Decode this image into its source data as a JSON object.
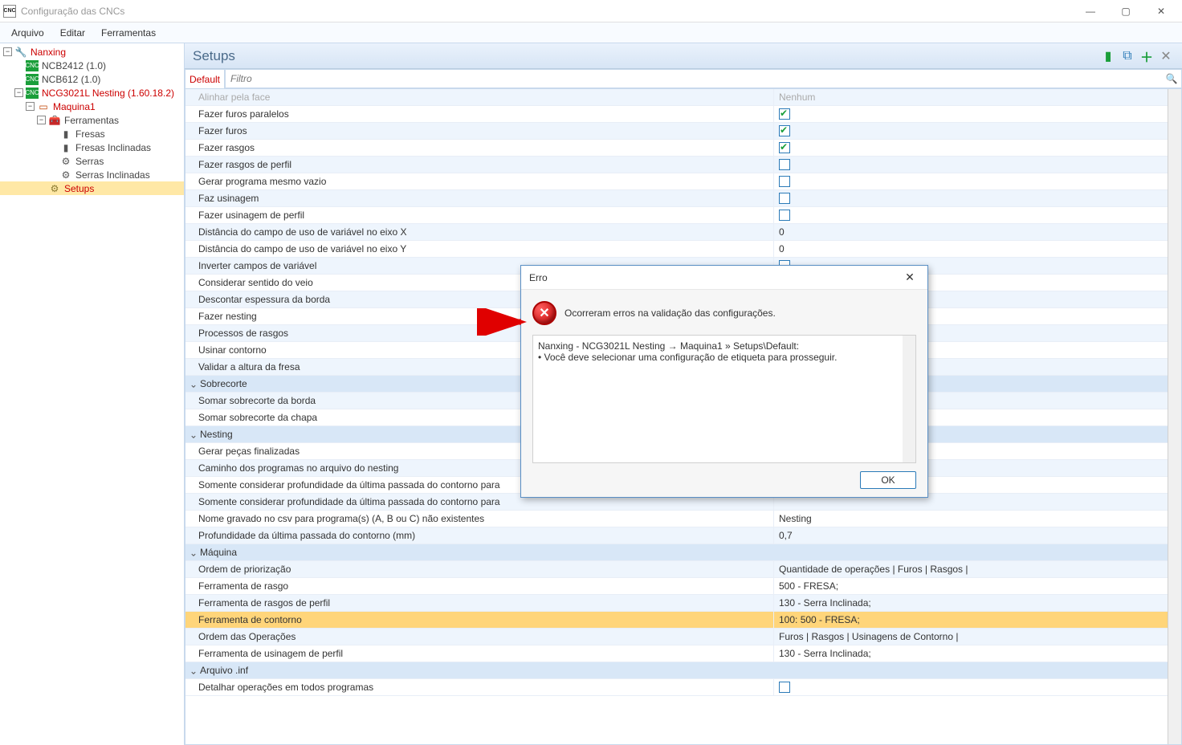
{
  "window": {
    "title": "Configuração das CNCs"
  },
  "menu": {
    "arquivo": "Arquivo",
    "editar": "Editar",
    "ferramentas": "Ferramentas"
  },
  "tree": {
    "root": "Nanxing",
    "ncb2412": "NCB2412 (1.0)",
    "ncb612": "NCB612 (1.0)",
    "ncg": "NCG3021L Nesting (1.60.18.2)",
    "maquina": "Maquina1",
    "ferr": "Ferramentas",
    "fresas": "Fresas",
    "fresas_inc": "Fresas Inclinadas",
    "serras": "Serras",
    "serras_inc": "Serras Inclinadas",
    "setups": "Setups"
  },
  "page": {
    "title": "Setups"
  },
  "tabs": {
    "default": "Default"
  },
  "filter": {
    "placeholder": "Filtro"
  },
  "rows": [
    {
      "type": "item",
      "label": "Alinhar pela face",
      "value": "Nenhum",
      "stripe": true,
      "faint": true
    },
    {
      "type": "item",
      "label": "Fazer furos paralelos",
      "value": "check:true"
    },
    {
      "type": "item",
      "label": "Fazer furos",
      "value": "check:true",
      "stripe": true
    },
    {
      "type": "item",
      "label": "Fazer rasgos",
      "value": "check:true"
    },
    {
      "type": "item",
      "label": "Fazer rasgos de perfil",
      "value": "check:false",
      "stripe": true
    },
    {
      "type": "item",
      "label": "Gerar programa mesmo vazio",
      "value": "check:false"
    },
    {
      "type": "item",
      "label": "Faz usinagem",
      "value": "check:false",
      "stripe": true
    },
    {
      "type": "item",
      "label": "Fazer usinagem de perfil",
      "value": "check:false"
    },
    {
      "type": "item",
      "label": "Distância do campo de uso de variável no eixo X",
      "value": "0",
      "stripe": true
    },
    {
      "type": "item",
      "label": "Distância do campo de uso de variável no eixo Y",
      "value": "0"
    },
    {
      "type": "item",
      "label": "Inverter campos de variável",
      "value": "check:false",
      "stripe": true
    },
    {
      "type": "item",
      "label": "Considerar sentido do veio",
      "value": ""
    },
    {
      "type": "item",
      "label": "Descontar espessura da borda",
      "value": "",
      "stripe": true
    },
    {
      "type": "item",
      "label": "Fazer nesting",
      "value": ""
    },
    {
      "type": "item",
      "label": "Processos de rasgos",
      "value": "",
      "stripe": true
    },
    {
      "type": "item",
      "label": "Usinar contorno",
      "value": ""
    },
    {
      "type": "item",
      "label": "Validar a altura da fresa",
      "value": "",
      "stripe": true
    },
    {
      "type": "section",
      "label": "Sobrecorte"
    },
    {
      "type": "item",
      "label": "Somar sobrecorte da borda",
      "value": "",
      "stripe": true
    },
    {
      "type": "item",
      "label": "Somar sobrecorte da chapa",
      "value": ""
    },
    {
      "type": "section",
      "label": "Nesting"
    },
    {
      "type": "item",
      "label": "Gerar peças finalizadas",
      "value": ""
    },
    {
      "type": "item",
      "label": "Caminho dos programas no arquivo do nesting",
      "value": "",
      "stripe": true
    },
    {
      "type": "item",
      "label": "Somente considerar profundidade da última passada do contorno para",
      "value": ""
    },
    {
      "type": "item",
      "label": "Somente considerar profundidade da última passada do contorno para",
      "value": "",
      "stripe": true
    },
    {
      "type": "item",
      "label": "Nome gravado no csv para programa(s) (A, B ou C) não existentes",
      "value": "Nesting"
    },
    {
      "type": "item",
      "label": "Profundidade da última passada do contorno (mm)",
      "value": "0,7",
      "stripe": true
    },
    {
      "type": "section",
      "label": "Máquina"
    },
    {
      "type": "item",
      "label": "Ordem de priorização",
      "value": "Quantidade de operações | Furos | Rasgos |",
      "stripe": true
    },
    {
      "type": "item",
      "label": "Ferramenta de rasgo",
      "value": "500 - FRESA;"
    },
    {
      "type": "item",
      "label": "Ferramenta de rasgos de perfil",
      "value": "130 - Serra Inclinada;",
      "stripe": true
    },
    {
      "type": "item",
      "label": "Ferramenta de contorno",
      "value": "100: 500 - FRESA;",
      "highlight": true
    },
    {
      "type": "item",
      "label": "Ordem das Operações",
      "value": "Furos | Rasgos | Usinagens de Contorno |",
      "stripe": true
    },
    {
      "type": "item",
      "label": "Ferramenta de usinagem de perfil",
      "value": "130 - Serra Inclinada;"
    },
    {
      "type": "section",
      "label": "Arquivo .inf"
    },
    {
      "type": "item",
      "label": "Detalhar operações em todos programas",
      "value": "check:false"
    }
  ],
  "dialog": {
    "title": "Erro",
    "message": "Ocorreram erros na validação das configurações.",
    "details_l1": "Nanxing - NCG3021L Nesting → Maquina1 » Setups\\Default:",
    "details_l2": "• Você deve selecionar uma configuração de etiqueta para prosseguir.",
    "ok": "OK"
  }
}
